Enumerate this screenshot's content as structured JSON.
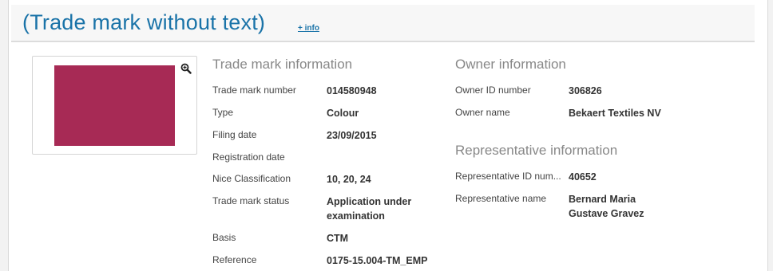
{
  "header": {
    "title": "(Trade mark without text)",
    "info_link": "+ info"
  },
  "image": {
    "colour": "#a72a55",
    "zoom_icon": "zoom-in-icon"
  },
  "trade_mark_info": {
    "title": "Trade mark information",
    "rows": [
      {
        "label": "Trade mark number",
        "value": "014580948"
      },
      {
        "label": "Type",
        "value": "Colour"
      },
      {
        "label": "Filing date",
        "value": "23/09/2015"
      },
      {
        "label": "Registration date",
        "value": ""
      },
      {
        "label": "Nice Classification",
        "value": "10, 20, 24"
      },
      {
        "label": "Trade mark status",
        "value": [
          "Application under",
          "examination"
        ]
      },
      {
        "label": "Basis",
        "value": "CTM"
      },
      {
        "label": "Reference",
        "value": "0175-15.004-TM_EMP"
      }
    ]
  },
  "owner_info": {
    "title": "Owner information",
    "rows": [
      {
        "label": "Owner ID number",
        "value": "306826"
      },
      {
        "label": "Owner name",
        "value": "Bekaert Textiles NV"
      }
    ]
  },
  "representative_info": {
    "title": "Representative information",
    "rows": [
      {
        "label": "Representative ID num...",
        "value": "40652"
      },
      {
        "label": "Representative name",
        "value": [
          "Bernard Maria",
          "Gustave Gravez"
        ]
      }
    ]
  },
  "colors": {
    "title_blue": "#1a73a8",
    "swatch": "#a72a55"
  }
}
